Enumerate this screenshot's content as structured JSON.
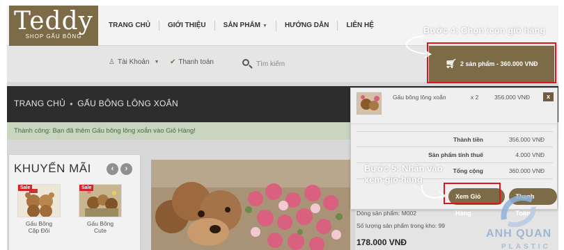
{
  "logo": {
    "word": "Teddy",
    "sub": "SHOP GẤU BÔNG"
  },
  "nav": [
    {
      "label": "TRANG CHỦ",
      "caret": false
    },
    {
      "label": "GIỚI THIỆU",
      "caret": false
    },
    {
      "label": "SẢN PHẨM",
      "caret": true
    },
    {
      "label": "HƯỚNG DẪN",
      "caret": false
    },
    {
      "label": "LIÊN HỆ",
      "caret": false
    }
  ],
  "subbar": {
    "account": "Tài Khoản",
    "checkout": "Thanh toán"
  },
  "search": {
    "placeholder": "Tìm kiếm"
  },
  "cart": {
    "label": "2 sản phẩm - 360.000 VNĐ"
  },
  "annotations": {
    "step4": "Bước 4: Chọn icon giỏ hàng",
    "step5_line1": "Bước 5: Nhấn vào",
    "step5_line2": "xem giỏ hàng"
  },
  "breadcrumb": {
    "home": "TRANG CHỦ",
    "current": "GẤU BÔNG LÔNG XOẮN"
  },
  "alert": "Thành công: Bạn đã thêm Gấu bông lông xoắn vào Giỏ Hàng!",
  "promo": {
    "title": "KHUYẾN MÃI",
    "prev": "‹",
    "next": "›",
    "items": [
      {
        "sale": "Sale",
        "name_line1": "Gấu Bông",
        "name_line2": "Cặp Đôi"
      },
      {
        "sale": "Sale",
        "name_line1": "Gấu Bông",
        "name_line2": "Cute"
      }
    ]
  },
  "dropdown": {
    "item": {
      "name": "Gấu bông lông xoắn",
      "qty": "x 2",
      "price": "356.000 VNĐ",
      "remove": "x"
    },
    "totals": [
      {
        "label": "Thành tiền",
        "value": "356.000 VNĐ"
      },
      {
        "label": "Sản phẩm tính thuế",
        "value": "4.000 VNĐ"
      },
      {
        "label": "Tổng cộng",
        "value": "360.000 VNĐ"
      }
    ],
    "view_cart": "Xem Giỏ Hàng",
    "checkout": "Thanh Toán"
  },
  "product": {
    "line": "Dòng sản phẩm: M002",
    "stock": "Số lượng sản phẩm trong kho: 99",
    "price": "178.000 VNĐ"
  },
  "watermark": {
    "name": "ANH QUAN",
    "sub": "PLASTIC"
  },
  "colors": {
    "brand": "#7d6a47",
    "highlight": "#e0141e",
    "dark_band": "#2d2d2d",
    "alert_bg": "#c9d4c1"
  }
}
